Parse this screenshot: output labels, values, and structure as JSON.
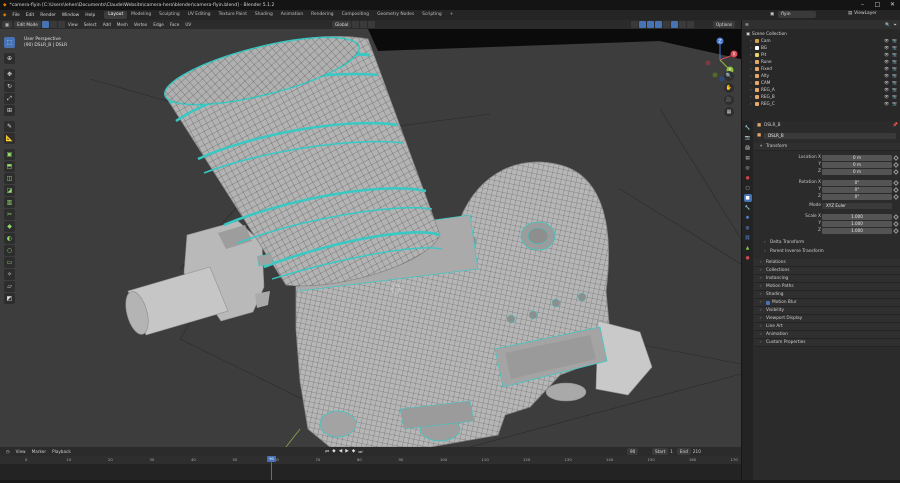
{
  "window": {
    "title": "*camera-flyin [C:\\Users\\lehen\\Documents\\Claude\\Website\\camera-hero\\blender\\camera-flyin.blend] - Blender 5.1.2"
  },
  "menu": {
    "items": [
      "File",
      "Edit",
      "Render",
      "Window",
      "Help"
    ],
    "workspaces": [
      "Layout",
      "Modeling",
      "Sculpting",
      "UV Editing",
      "Texture Paint",
      "Shading",
      "Animation",
      "Rendering",
      "Compositing",
      "Geometry Nodes",
      "Scripting",
      "+"
    ],
    "active_workspace": "Layout",
    "scene": "flyin",
    "view_layer": "ViewLayer"
  },
  "viewport_header": {
    "mode": "Edit Mode",
    "menus": [
      "View",
      "Select",
      "Add",
      "Mesh",
      "Vertex",
      "Edge",
      "Face",
      "UV"
    ],
    "orientation": "Global",
    "options": "Options"
  },
  "viewport": {
    "perspective": "User Perspective",
    "object_info": "(90) DSLR_B | DSLR",
    "toolbar_icons": [
      "select-box-icon",
      "cursor-icon",
      "move-icon",
      "rotate-icon",
      "scale-icon",
      "transform-icon",
      "annotate-icon",
      "measure-icon",
      "add-cube-icon",
      "extrude-icon",
      "inset-icon",
      "bevel-icon",
      "loop-cut-icon",
      "knife-icon",
      "poly-build-icon",
      "spin-icon",
      "smooth-icon",
      "edge-slide-icon",
      "shrink-icon",
      "shear-icon",
      "rip-icon"
    ],
    "gizmo": {
      "x": "X",
      "y": "Y",
      "z": "Z"
    }
  },
  "timeline": {
    "menus": [
      "View",
      "Marker",
      "Playback"
    ],
    "ticks": [
      "0",
      "10",
      "20",
      "30",
      "40",
      "50",
      "60",
      "70",
      "80",
      "90",
      "100",
      "110",
      "120",
      "130",
      "140",
      "150",
      "160",
      "170"
    ],
    "current_frame": "90",
    "start_label": "Start",
    "start": "1",
    "end_label": "End",
    "end": "210"
  },
  "outliner": {
    "header": "Scene Collection",
    "items": [
      {
        "label": "Cam",
        "color": "#d6a04a",
        "selected": false
      },
      {
        "label": "BG",
        "color": "#ffffff",
        "selected": false
      },
      {
        "label": "Pit",
        "color": "#e6d36a",
        "selected": false
      },
      {
        "label": "Rune",
        "color": "#e6a86a",
        "selected": false
      },
      {
        "label": "Fixed",
        "color": "#e6a86a",
        "selected": false
      },
      {
        "label": "Alty",
        "color": "#e6a86a",
        "selected": false
      },
      {
        "label": "CAM",
        "color": "#e6a86a",
        "selected": false
      },
      {
        "label": "REG_A",
        "color": "#e6a86a",
        "selected": false
      },
      {
        "label": "REG_B",
        "color": "#e6a86a",
        "selected": false
      },
      {
        "label": "REG_C",
        "color": "#e6a86a",
        "selected": false
      }
    ]
  },
  "properties": {
    "object_name": "DSLR_B",
    "object_sub": "DSLR_B",
    "transform_label": "Transform",
    "location_label": "Location X",
    "rotation_label": "Rotation X",
    "scale_label": "Scale X",
    "y_label": "Y",
    "z_label": "Z",
    "mode_label": "Mode",
    "location": [
      "0 m",
      "0 m",
      "0 m"
    ],
    "rotation": [
      "0°",
      "0°",
      "0°"
    ],
    "scale": [
      "1.000",
      "1.000",
      "1.000"
    ],
    "mode": "XYZ Euler",
    "sub_panels": [
      "Delta Transform",
      "Parent Inverse Transform"
    ],
    "panels": [
      "Relations",
      "Collections",
      "Instancing",
      "Motion Paths",
      "Shading",
      "Motion Blur",
      "Visibility",
      "Viewport Display",
      "Line Art",
      "Animation",
      "Custom Properties"
    ]
  },
  "colors": {
    "accent": "#4772b3",
    "wire_select": "#38c9c4",
    "mesh": "#b8b8b8",
    "viewport_bg": "#3d3d3d"
  }
}
